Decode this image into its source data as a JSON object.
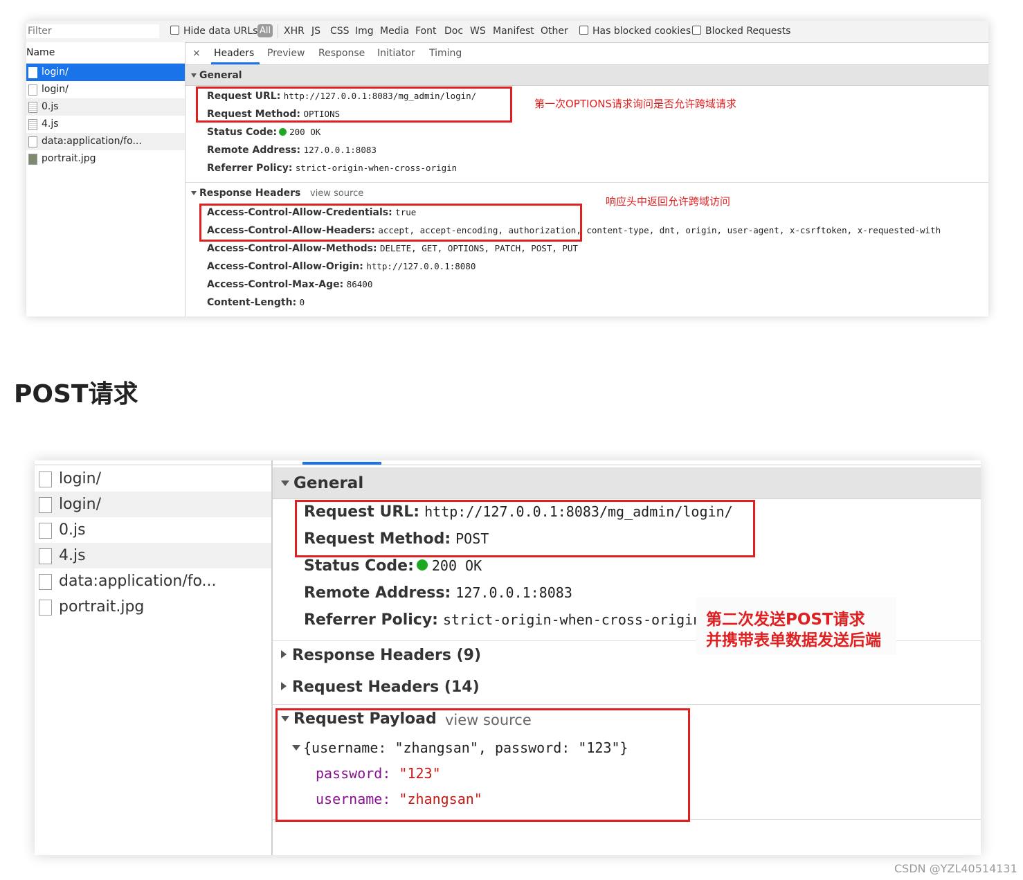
{
  "panel1": {
    "toolbar": {
      "filter_placeholder": "Filter",
      "hide_data_urls": "Hide data URLs",
      "all": "All",
      "types": [
        "XHR",
        "JS",
        "CSS",
        "Img",
        "Media",
        "Font",
        "Doc",
        "WS",
        "Manifest",
        "Other"
      ],
      "has_blocked_cookies": "Has blocked cookies",
      "blocked_requests": "Blocked Requests"
    },
    "name_header": "Name",
    "requests": [
      "login/",
      "login/",
      "0.js",
      "4.js",
      "data:application/fo...",
      "portrait.jpg"
    ],
    "tabs": {
      "close": "×",
      "items": [
        "Headers",
        "Preview",
        "Response",
        "Initiator",
        "Timing"
      ]
    },
    "general": {
      "title": "General",
      "request_url_k": "Request URL:",
      "request_url_v": "http://127.0.0.1:8083/mg_admin/login/",
      "request_method_k": "Request Method:",
      "request_method_v": "OPTIONS",
      "status_code_k": "Status Code:",
      "status_code_v": "200 OK",
      "remote_address_k": "Remote Address:",
      "remote_address_v": "127.0.0.1:8083",
      "referrer_policy_k": "Referrer Policy:",
      "referrer_policy_v": "strict-origin-when-cross-origin"
    },
    "response_headers": {
      "title": "Response Headers",
      "view_source": "view source",
      "rows": [
        {
          "k": "Access-Control-Allow-Credentials:",
          "v": "true"
        },
        {
          "k": "Access-Control-Allow-Headers:",
          "v": "accept, accept-encoding, authorization, content-type, dnt, origin, user-agent, x-csrftoken, x-requested-with"
        },
        {
          "k": "Access-Control-Allow-Methods:",
          "v": "DELETE, GET, OPTIONS, PATCH, POST, PUT"
        },
        {
          "k": "Access-Control-Allow-Origin:",
          "v": "http://127.0.0.1:8080"
        },
        {
          "k": "Access-Control-Max-Age:",
          "v": "86400"
        },
        {
          "k": "Content-Length:",
          "v": "0"
        }
      ]
    },
    "annotations": {
      "first": "第一次OPTIONS请求询问是否允许跨域请求",
      "second": "响应头中返回允许跨域访问"
    }
  },
  "heading": "POST请求",
  "panel2": {
    "requests": [
      "login/",
      "login/",
      "0.js",
      "4.js",
      "data:application/fo...",
      "portrait.jpg"
    ],
    "general": {
      "title": "General",
      "request_url_k": "Request URL:",
      "request_url_v": "http://127.0.0.1:8083/mg_admin/login/",
      "request_method_k": "Request Method:",
      "request_method_v": "POST",
      "status_code_k": "Status Code:",
      "status_code_v": "200 OK",
      "remote_address_k": "Remote Address:",
      "remote_address_v": "127.0.0.1:8083",
      "referrer_policy_k": "Referrer Policy:",
      "referrer_policy_v": "strict-origin-when-cross-origin"
    },
    "response_headers": "Response Headers (9)",
    "request_headers": "Request Headers (14)",
    "payload": {
      "title": "Request Payload",
      "view_source": "view source",
      "summary": "{username: \"zhangsan\", password: \"123\"}",
      "password_k": "password:",
      "password_v": "\"123\"",
      "username_k": "username:",
      "username_v": "\"zhangsan\""
    },
    "annotation": {
      "line1": "第二次发送POST请求",
      "line2": "并携带表单数据发送后端"
    }
  },
  "watermark": "CSDN @YZL40514131",
  "colors": {
    "accent": "#1a73e8",
    "annotation_red": "#e02020",
    "status_green": "#1fa824",
    "json_key": "#881391",
    "json_string": "#c41a16"
  }
}
